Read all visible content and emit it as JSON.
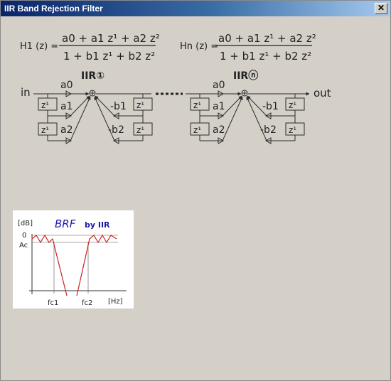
{
  "window": {
    "title": "IIR Band Rejection Filter",
    "close_glyph": "✕"
  },
  "formula": {
    "h1_label": "H1 (z) =",
    "hn_label": "Hn (z) =",
    "numerator": "a0  +  a1 z¹  +  a2 z²",
    "denominator": "1  +  b1 z¹  +  b2 z²"
  },
  "diagram": {
    "input_label": "in",
    "output_label": "out",
    "stage1_label": "IIR①",
    "stagen_label": "IIRⓝ",
    "delay_label": "z¹",
    "sum_glyph": "⊕",
    "coef": {
      "a0": "a0",
      "a1": "a1",
      "a2": "a2",
      "b1": "-b1",
      "b2": "-b2"
    },
    "colors": {
      "line": "#2c2c2c",
      "background": "#d4d0c8"
    }
  },
  "chart_data": {
    "type": "line",
    "title": "BRF",
    "subtitle": "by IIR",
    "ylabel": "[dB]",
    "xlabel": "[Hz]",
    "y_ticks": [
      "0",
      "Ac"
    ],
    "x_ticks": [
      "fc1",
      "fc2"
    ],
    "colors": {
      "response": "#cc2222",
      "title": "#1a1aa8",
      "grid": "#555555"
    }
  }
}
